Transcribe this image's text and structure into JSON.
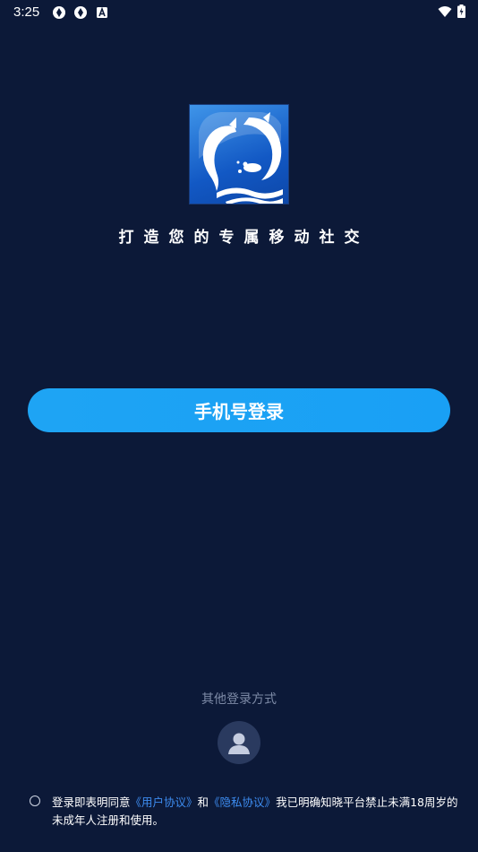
{
  "status_bar": {
    "time": "3:25",
    "left_icons": [
      "aperture-icon",
      "aperture-icon",
      "a-letter-icon"
    ],
    "right_icons": [
      "wifi-icon",
      "battery-charging-icon"
    ]
  },
  "logo": {
    "icon": "dolphin-logo-icon"
  },
  "tagline": "打造您的专属移动社交",
  "phone_login_button": "手机号登录",
  "other_login": {
    "label": "其他登录方式",
    "icon": "user-avatar-icon"
  },
  "agreement": {
    "prefix": "登录即表明同意",
    "user_agreement": "《用户协议》",
    "and": "和",
    "privacy_agreement": "《隐私协议》",
    "suffix": "我已明确知晓平台禁止未满18周岁的未成年人注册和使用。"
  },
  "colors": {
    "background": "#0c1938",
    "button": "#1ea4f4",
    "link": "#3d8cf0",
    "muted_text": "#7d8aa6"
  }
}
